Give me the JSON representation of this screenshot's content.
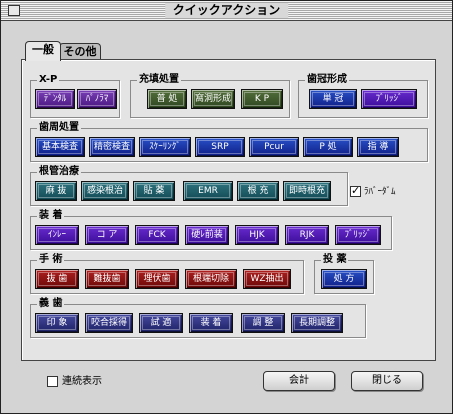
{
  "window": {
    "title": "クイックアクション"
  },
  "tabs": [
    {
      "label": "一般",
      "active": true
    },
    {
      "label": "その他",
      "active": false
    }
  ],
  "groups": {
    "xp": {
      "label": "X-P",
      "buttons": [
        "ﾃﾞﾝﾀﾙ",
        "ﾊﾟﾉﾗﾏ"
      ]
    },
    "prevention": {
      "label": "充填処置",
      "buttons": [
        "普 処",
        "窩洞形成",
        "K P"
      ]
    },
    "crown": {
      "label": "歯冠形成",
      "buttons": [
        "単 冠",
        "ﾌﾞﾘｯｼﾞ"
      ]
    },
    "perio": {
      "label": "歯周処置",
      "buttons": [
        "基本検査",
        "精密検査",
        "ｽｹｰﾘﾝｸﾞ",
        "SRP",
        "Pcur",
        "P 処",
        "指 導"
      ]
    },
    "root": {
      "label": "根管治療",
      "buttons": [
        "麻 抜",
        "感染根治",
        "貼 薬",
        "EMR",
        "根 充",
        "即時根充"
      ],
      "checkbox_label": "ﾗﾊﾞｰﾀﾞﾑ",
      "checkbox_checked": true
    },
    "prosth": {
      "label": "装 着",
      "buttons": [
        "ｲﾝﾚｰ",
        "コ ア",
        "FCK",
        "硬ﾚ前装",
        "HJK",
        "RJK",
        "ﾌﾞﾘｯｼﾞ"
      ]
    },
    "surgery": {
      "label": "手 術",
      "buttons": [
        "抜 歯",
        "難抜歯",
        "埋伏歯",
        "根端切除",
        "WZ抽出"
      ]
    },
    "rx": {
      "label": "投 薬",
      "buttons": [
        "処 方"
      ]
    },
    "impression": {
      "label": "義 歯",
      "buttons": [
        "印 象",
        "咬合採得",
        "試 適",
        "装 着",
        "調 整",
        "長期調整"
      ]
    }
  },
  "footer": {
    "continuous_label": "連続表示",
    "continuous_checked": false,
    "accounting_label": "会計",
    "close_label": "閉じる"
  },
  "colors": {
    "purple": "#5a2896",
    "olive": "#3c5a28",
    "blue": "#1a32a8",
    "teal": "#1e5a64",
    "violet": "#4a1ab8",
    "red": "#8c1010",
    "slate": "#2a2e80"
  }
}
